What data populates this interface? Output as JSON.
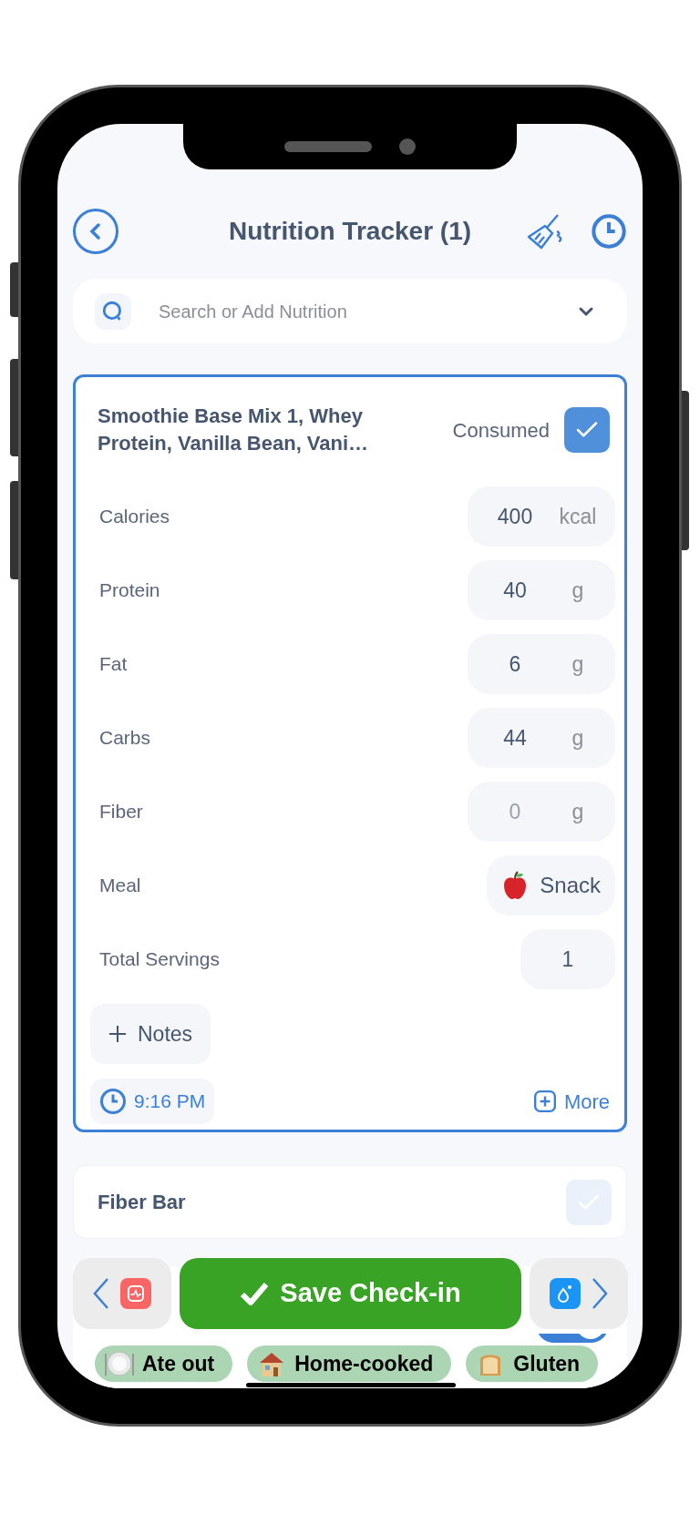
{
  "header": {
    "title": "Nutrition Tracker (1)"
  },
  "search": {
    "placeholder": "Search or Add Nutrition"
  },
  "items": [
    {
      "name": "Smoothie Base Mix 1, Whey Protein, Vanilla Bean, Vani…",
      "expanded": true,
      "consumed": true,
      "consumed_label": "Consumed",
      "fields": [
        {
          "label": "Calories",
          "kind": "number",
          "value": "400",
          "unit": "kcal"
        },
        {
          "label": "Protein",
          "kind": "number",
          "value": "40",
          "unit": "g"
        },
        {
          "label": "Fat",
          "kind": "number",
          "value": "6",
          "unit": "g"
        },
        {
          "label": "Carbs",
          "kind": "number",
          "value": "44",
          "unit": "g"
        },
        {
          "label": "Fiber",
          "kind": "number",
          "placeholder": "0",
          "unit": "g"
        },
        {
          "label": "Meal",
          "kind": "select",
          "value": "Snack"
        },
        {
          "label": "Total Servings",
          "kind": "number",
          "value": "1"
        }
      ],
      "notes_label": "Notes",
      "time": "9:16 PM",
      "more_label": "More"
    },
    {
      "name": "Fiber Bar",
      "expanded": false,
      "consumed": false
    }
  ],
  "save_button": "Save Check-in",
  "toggle": {
    "on": true
  },
  "chips": [
    {
      "label": "Ate out"
    },
    {
      "label": "Home-cooked"
    },
    {
      "label": "Gluten"
    }
  ]
}
